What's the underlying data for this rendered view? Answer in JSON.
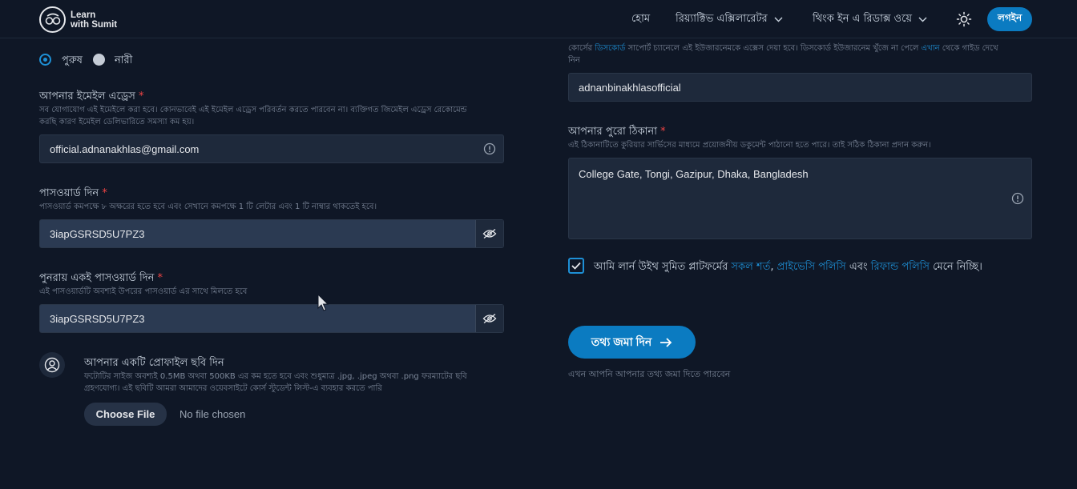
{
  "header": {
    "logo_line1": "Learn",
    "logo_line2": "with Sumit",
    "nav_home": "হোম",
    "nav_react": "রিয়্যাক্টিভ এক্সিলারেটর",
    "nav_think": "থিংক ইন এ রিডাক্স ওয়ে",
    "login_label": "লগইন"
  },
  "gender": {
    "male_label": "পুরুষ",
    "female_label": "নারী",
    "selected": "পুরুষ"
  },
  "email": {
    "label": "আপনার ইমেইল এড্রেস",
    "required_mark": "*",
    "hint_line1": "সব যোগাযোগ এই ইমেইলে করা হবে। কোনভাবেই এই ইমেইল এড্রেস পরিবর্তন করতে পারবেন না। ব্যক্তিগত জিমেইল এড্রেস রেকোমেন্ড",
    "hint_line2": "করছি কারণ ইমেইল ডেলিভারিতে সমস্যা কম হয়।",
    "value": "official.adnanakhlas@gmail.com"
  },
  "password": {
    "label": "পাসওয়ার্ড দিন",
    "required_mark": "*",
    "hint": "পাসওয়ার্ড কমপক্ষে ৮ অক্ষরের হতে হবে এবং সেখানে কমপক্ষে 1 টি লেটার এবং 1 টি নাম্বার থাকতেই হবে।",
    "value": "3iapGSRSD5U7PZ3"
  },
  "confirm_password": {
    "label": "পুনরায় একই পাসওয়ার্ড দিন",
    "required_mark": "*",
    "hint": "এই পাসওয়ার্ডটি অবশ্যই উপরের পাসওয়ার্ড এর সাথে মিলতে হবে",
    "value": "3iapGSRSD5U7PZ3"
  },
  "profile": {
    "title": "আপনার একটি প্রোফাইল ছবি দিন",
    "hint_line1": "ফটোটির সাইজ অবশ্যই 0.5MB অথবা 500KB এর কম হতে হবে এবং শুধুমাত্র .jpg, .jpeg অথবা .png ফরম্যাটের ছবি",
    "hint_line2": "গ্রহণযোগ্য। এই ছবিটি আমরা আমাদের ওয়েবসাইটে কোর্স স্টুডেন্ট লিস্ট-এ ব্যবহার করতে পারি",
    "choose_label": "Choose File",
    "no_file": "No file chosen"
  },
  "discord": {
    "hint_line1_a": "কোর্সের",
    "hint_line1_link": "ডিসকোর্ড",
    "hint_line1_b": "সাপোর্ট চ্যানেলে এই ইউজারনেমকে এক্সেস দেয়া হবে। ডিসকোর্ড ইউজারনেম খুঁজে না পেলে",
    "hint_line1_link2": "এখান",
    "hint_line1_c": "থেকে গাইড দেখে",
    "hint_line2": "নিন",
    "value": "adnanbinakhlasofficial"
  },
  "address": {
    "label": "আপনার পুরো ঠিকানা",
    "required_mark": "*",
    "hint": "এই ঠিকানাটিতে কুরিয়ার সার্ভিসের মাধ্যমে প্রয়োজনীয় ডকুমেন্ট পাঠানো হতে পারে। তাই সঠিক ঠিকানা প্রদান করুন।",
    "value": "College Gate, Tongi, Gazipur, Dhaka, Bangladesh"
  },
  "terms": {
    "prefix": "আমি লার্ন উইথ সুমিত প্লাটফর্মের",
    "link1": "সকল শর্ত",
    "sep": ",",
    "link2": "প্রাইভেসি পলিসি",
    "mid": "এবং",
    "link3": "রিফান্ড পলিসি",
    "suffix": "মেনে নিচ্ছি।",
    "checked": true
  },
  "submit": {
    "label": "তথ্য জমা দিন",
    "note": "এখন আপনি আপনার তথ্য জমা দিতে পারবেন"
  },
  "colors": {
    "background": "#0f1726",
    "accent": "#0b7bc1",
    "field": "#1e293b",
    "link": "#1e90d6",
    "required": "#ef4444"
  }
}
